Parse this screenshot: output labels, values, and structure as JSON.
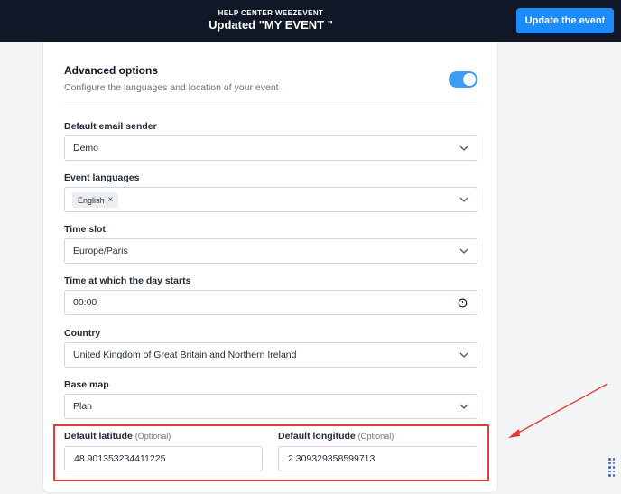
{
  "header": {
    "eyebrow": "HELP CENTER WEEZEVENT",
    "title": "Updated \"MY EVENT \"",
    "update_button": "Update the event"
  },
  "advanced": {
    "title": "Advanced options",
    "subtitle": "Configure the languages and location of your event",
    "enabled": true
  },
  "fields": {
    "email_sender": {
      "label": "Default email sender",
      "value": "Demo"
    },
    "languages": {
      "label": "Event languages",
      "chips": [
        "English"
      ]
    },
    "time_slot": {
      "label": "Time slot",
      "value": "Europe/Paris"
    },
    "day_start": {
      "label": "Time at which the day starts",
      "value": "00:00"
    },
    "country": {
      "label": "Country",
      "value": "United Kingdom of Great Britain and Northern Ireland"
    },
    "base_map": {
      "label": "Base map",
      "value": "Plan"
    }
  },
  "coordinates": {
    "latitude_label": "Default latitude",
    "latitude_optional": "(Optional)",
    "latitude_value": "48.901353234411225",
    "longitude_label": "Default longitude",
    "longitude_optional": "(Optional)",
    "longitude_value": "2.309329358599713"
  },
  "colors": {
    "topbar": "#101828",
    "accent": "#1a8cff",
    "toggle": "#3b9bf5",
    "annotation": "#e53935"
  }
}
